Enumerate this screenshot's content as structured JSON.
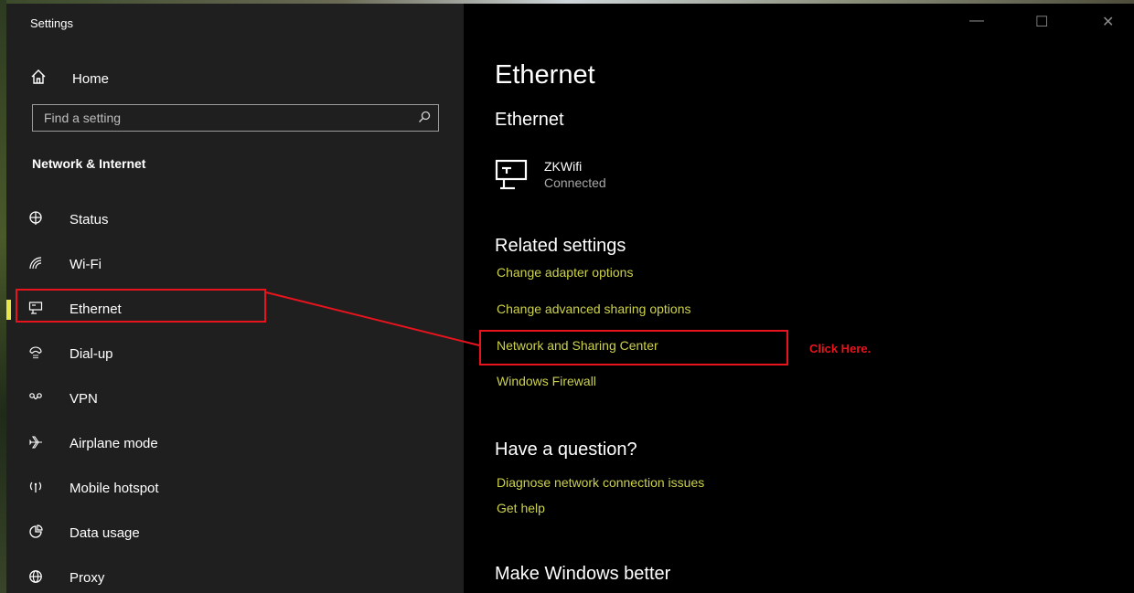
{
  "window": {
    "title": "Settings",
    "controls": {
      "minimize": "—",
      "maximize": "☐",
      "close": "✕"
    }
  },
  "sidebar": {
    "home": {
      "icon": "home-icon",
      "label": "Home"
    },
    "search": {
      "placeholder": "Find a setting",
      "icon": "search-icon"
    },
    "section_title": "Network & Internet",
    "items": [
      {
        "icon": "globe-status-icon",
        "label": "Status"
      },
      {
        "icon": "wifi-icon",
        "label": "Wi-Fi"
      },
      {
        "icon": "ethernet-icon",
        "label": "Ethernet",
        "active": true
      },
      {
        "icon": "dialup-icon",
        "label": "Dial-up"
      },
      {
        "icon": "vpn-icon",
        "label": "VPN"
      },
      {
        "icon": "airplane-icon",
        "label": "Airplane mode"
      },
      {
        "icon": "hotspot-icon",
        "label": "Mobile hotspot"
      },
      {
        "icon": "data-usage-icon",
        "label": "Data usage"
      },
      {
        "icon": "proxy-icon",
        "label": "Proxy"
      }
    ]
  },
  "main": {
    "page_title": "Ethernet",
    "ethernet_heading": "Ethernet",
    "connection": {
      "name": "ZKWifi",
      "status": "Connected"
    },
    "related": {
      "heading": "Related settings",
      "links": [
        "Change adapter options",
        "Change advanced sharing options",
        "Network and Sharing Center",
        "Windows Firewall"
      ]
    },
    "question": {
      "heading": "Have a question?",
      "links": [
        "Diagnose network connection issues",
        "Get help"
      ]
    },
    "better_heading": "Make Windows better"
  },
  "annotation": {
    "text": "Click Here.",
    "color": "#e8141d"
  },
  "colors": {
    "accent": "#e8e84a",
    "link": "#cdd24a",
    "sidebar_bg": "#1f1f1f",
    "main_bg": "#000000"
  }
}
